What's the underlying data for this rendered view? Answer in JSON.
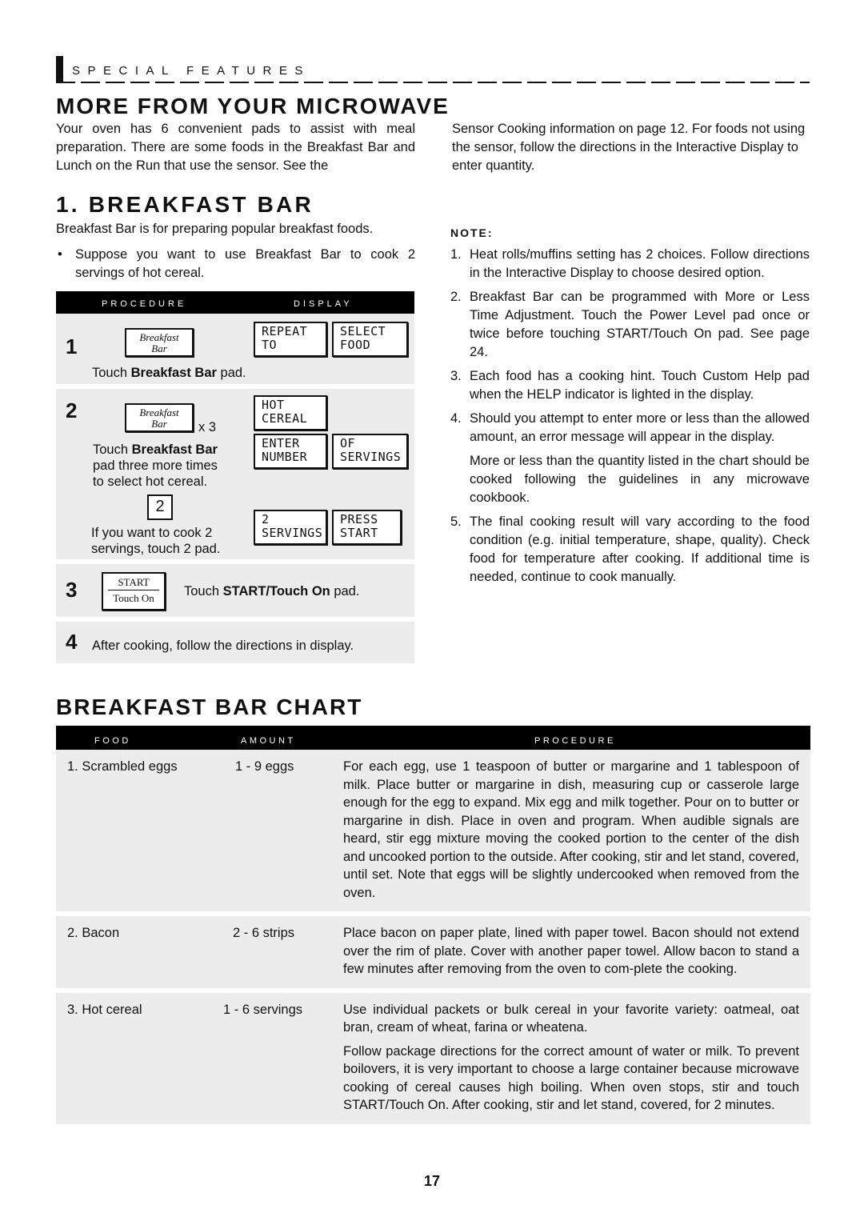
{
  "section_header": "SPECIAL FEATURES",
  "main_title": "MORE FROM YOUR MICROWAVE",
  "intro": {
    "left": "Your oven has 6 convenient pads to assist with meal preparation. There are some foods in the Breakfast Bar and Lunch on the Run that use the sensor. See the",
    "right": "Sensor Cooking information on page 12. For foods not using the sensor, follow the directions in the Interactive Display to enter quantity."
  },
  "breakfast_bar": {
    "title": "1. BREAKFAST BAR",
    "description": "Breakfast Bar is for preparing popular breakfast foods.",
    "bullet": "Suppose you want to use Breakfast Bar to cook 2 servings of hot cereal.",
    "bullet_glyph": "•"
  },
  "procedure_table": {
    "headers": {
      "procedure": "PROCEDURE",
      "display": "DISPLAY"
    },
    "steps": [
      {
        "number": "1",
        "pad_line1": "Breakfast",
        "pad_line2": "Bar",
        "text_prefix": "Touch ",
        "text_bold": "Breakfast Bar",
        "text_suffix": " pad.",
        "displays": [
          "REPEAT\nTO",
          "SELECT\nFOOD"
        ]
      },
      {
        "number": "2",
        "pad_line1": "Breakfast",
        "pad_line2": "Bar",
        "multiplier": "x 3",
        "text_prefix": "Touch ",
        "text_bold": "Breakfast Bar",
        "text_line2": "pad three more times",
        "text_line3": "to select hot cereal.",
        "number_pad": "2",
        "number_text_line1": "If you want to cook 2",
        "number_text_line2": "servings, touch 2 pad.",
        "displays": [
          "HOT\nCEREAL",
          "ENTER\nNUMBER",
          "OF\nSERVINGS",
          "2\nSERVINGS",
          "PRESS\nSTART"
        ]
      },
      {
        "number": "3",
        "pad_line1": "START",
        "pad_line2": "Touch On",
        "text_prefix": "Touch ",
        "text_bold": "START/Touch On",
        "text_suffix": " pad."
      },
      {
        "number": "4",
        "text": "After cooking, follow the directions in display."
      }
    ]
  },
  "notes": {
    "title": "NOTE:",
    "items": [
      {
        "n": "1.",
        "text": "Heat rolls/muffins setting has 2 choices. Follow directions in the Interactive Display to choose desired option."
      },
      {
        "n": "2.",
        "text": "Breakfast Bar can be programmed with More or Less Time Adjustment. Touch the Power Level pad once or twice before touching START/Touch On pad. See page 24."
      },
      {
        "n": "3.",
        "text": "Each food has a cooking hint. Touch Custom Help pad when the HELP indicator is lighted in the display."
      },
      {
        "n": "4.",
        "text": "Should you attempt to enter more or less than the allowed amount, an error message will appear in the display.",
        "extra": "More or less than the quantity listed in the chart should be cooked following the guidelines in any microwave cookbook."
      },
      {
        "n": "5.",
        "text": "The final cooking result will vary according to the food condition (e.g. initial temperature, shape, quality). Check food for temperature after cooking. If additional time is needed, continue to cook manually."
      }
    ]
  },
  "chart": {
    "title": "BREAKFAST BAR CHART",
    "headers": {
      "food": "FOOD",
      "amount": "AMOUNT",
      "procedure": "PROCEDURE"
    },
    "rows": [
      {
        "food": "1. Scrambled eggs",
        "amount": "1 - 9 eggs",
        "procedure": [
          "For each egg, use 1 teaspoon of butter or margarine and 1 tablespoon of milk. Place butter or margarine in dish, measuring cup or casserole large enough for the egg to expand. Mix egg and milk together. Pour on to butter or margarine in dish. Place in oven and program. When audible signals are heard, stir egg mixture moving the cooked portion to the center of the dish and uncooked portion to the outside. After cooking, stir and let stand, covered, until set. Note that eggs will be slightly undercooked when removed from the oven."
        ]
      },
      {
        "food": "2. Bacon",
        "amount": "2 - 6 strips",
        "procedure": [
          "Place bacon on paper plate, lined with paper towel. Bacon should not extend over the rim of plate. Cover with another paper towel. Allow bacon to stand a few minutes after removing from the oven to com-plete the cooking."
        ]
      },
      {
        "food": "3. Hot cereal",
        "amount": "1 - 6 servings",
        "procedure": [
          "Use individual packets or bulk cereal in your favorite variety: oatmeal, oat bran, cream of wheat, farina or wheatena.",
          "Follow package directions for the correct amount of water or milk. To prevent boilovers, it is very important to choose a large container because microwave cooking of cereal causes high boiling. When oven stops, stir and touch START/Touch On. After cooking, stir and let stand, covered, for 2 minutes."
        ]
      }
    ]
  },
  "page_number": "17"
}
